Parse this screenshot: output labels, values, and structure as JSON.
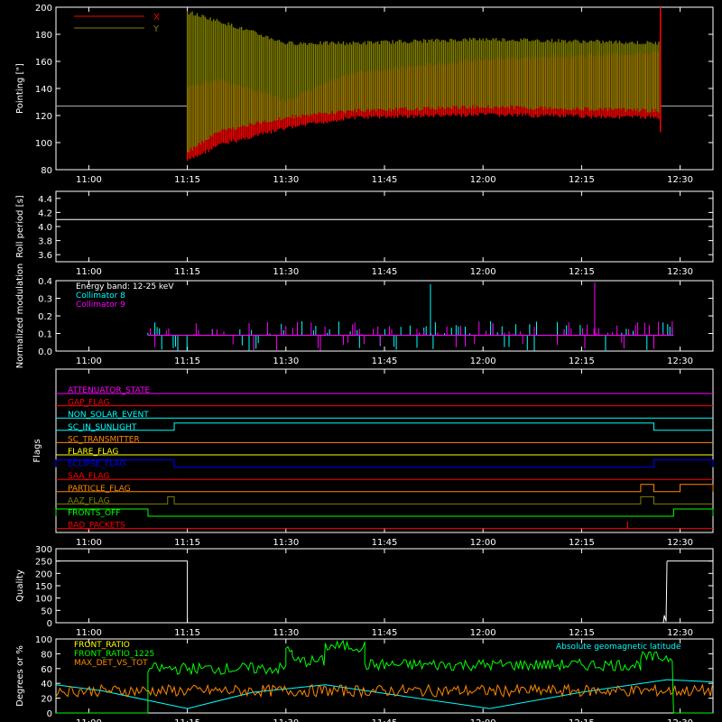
{
  "time_ticks": [
    "11:00",
    "11:15",
    "11:30",
    "11:45",
    "12:00",
    "12:15",
    "12:30"
  ],
  "colors": {
    "x": "#ff0000",
    "y": "#808000",
    "white": "#ffffff",
    "cyan": "#00ffff",
    "magenta": "#ff00ff",
    "green": "#00ff00",
    "orange": "#ff8800",
    "blue": "#0000ff"
  },
  "chart_data": [
    {
      "type": "line",
      "ylabel": "Pointing [\"]",
      "ylim": [
        80,
        200
      ],
      "yticks": [
        80,
        100,
        120,
        140,
        160,
        180,
        200
      ],
      "legend": [
        {
          "label": "X",
          "color": "#ff0000"
        },
        {
          "label": "Y",
          "color": "#808000"
        }
      ],
      "baseline": 127,
      "oscillation_start": "11:15",
      "oscillation_end": "12:27",
      "series": [
        {
          "name": "X",
          "color": "#ff0000",
          "envelope_time": [
            "11:15",
            "11:20",
            "11:30",
            "11:40",
            "12:00",
            "12:27"
          ],
          "envelope_low": [
            88,
            100,
            112,
            120,
            122,
            120
          ],
          "envelope_high": [
            140,
            145,
            130,
            150,
            160,
            165
          ]
        },
        {
          "name": "Y",
          "color": "#808000",
          "envelope_time": [
            "11:15",
            "11:20",
            "11:30",
            "11:40",
            "12:00",
            "12:27"
          ],
          "envelope_low": [
            95,
            110,
            120,
            125,
            128,
            125
          ],
          "envelope_high": [
            195,
            188,
            172,
            172,
            175,
            172
          ]
        }
      ]
    },
    {
      "type": "line",
      "ylabel": "Roll period [s]",
      "ylim": [
        3.5,
        4.5
      ],
      "yticks": [
        3.6,
        3.8,
        4.0,
        4.2,
        4.4
      ],
      "value": 4.1
    },
    {
      "type": "line",
      "ylabel": "Normalized modulation",
      "ylim": [
        0,
        0.4
      ],
      "yticks": [
        0.0,
        0.1,
        0.2,
        0.3,
        0.4
      ],
      "start": "11:09",
      "end": "12:29",
      "baseline": 0.09,
      "legend": [
        {
          "label": "Energy band: 12-25 keV",
          "color": "#ffffff"
        },
        {
          "label": "Collimator 8",
          "color": "#00ffff"
        },
        {
          "label": "Collimator 9",
          "color": "#ff00ff"
        }
      ]
    },
    {
      "type": "line",
      "ylabel": "Flags",
      "flags": [
        {
          "label": "ATTENUATOR_STATE",
          "color": "#ff00ff",
          "steps": []
        },
        {
          "label": "GAP_FLAG",
          "color": "#ff0000",
          "steps": []
        },
        {
          "label": "NON_SOLAR_EVENT",
          "color": "#00ffff",
          "steps": []
        },
        {
          "label": "SC_IN_SUNLIGHT",
          "color": "#00ffff",
          "steps": [
            [
              "11:13",
              "12:26"
            ]
          ]
        },
        {
          "label": "SC_TRANSMITTER",
          "color": "#ff8800",
          "steps": []
        },
        {
          "label": "FLARE_FLAG",
          "color": "#ffff00",
          "steps": []
        },
        {
          "label": "ECLIPSE_FLAG",
          "color": "#0000ff",
          "steps": [
            [
              "10:55",
              "11:13"
            ],
            [
              "12:26",
              "12:35"
            ]
          ]
        },
        {
          "label": "SAA_FLAG",
          "color": "#ff0000",
          "steps": []
        },
        {
          "label": "PARTICLE_FLAG",
          "color": "#ff8800",
          "steps": [
            [
              "12:24",
              "12:26"
            ],
            [
              "12:30",
              "12:35"
            ]
          ]
        },
        {
          "label": "AAZ_FLAG",
          "color": "#808000",
          "steps": [
            [
              "11:12",
              "11:13"
            ],
            [
              "12:24",
              "12:26"
            ]
          ]
        },
        {
          "label": "FRONTS_OFF",
          "color": "#00ff00",
          "steps": [
            [
              "10:55",
              "11:09"
            ],
            [
              "12:29",
              "12:35"
            ]
          ]
        },
        {
          "label": "BAD_PACKETS",
          "color": "#ff0000",
          "steps": [
            [
              "12:22",
              "12:22"
            ]
          ]
        }
      ]
    },
    {
      "type": "line",
      "ylabel": "Quality",
      "ylim": [
        0,
        300
      ],
      "yticks": [
        0,
        50,
        100,
        150,
        200,
        250,
        300
      ],
      "segments": [
        {
          "start": "10:55",
          "end": "11:15",
          "value": 250
        },
        {
          "start": "12:28",
          "end": "12:35",
          "value": 250
        }
      ]
    },
    {
      "type": "line",
      "ylabel": "Degrees or %",
      "ylim": [
        0,
        100
      ],
      "yticks": [
        0,
        20,
        40,
        60,
        80,
        100
      ],
      "legend": [
        {
          "label": "FRONT_RATIO",
          "color": "#ffff00"
        },
        {
          "label": "FRONT_RATIO_1225",
          "color": "#00ff00"
        },
        {
          "label": "MAX_DET_VS_TOT",
          "color": "#ff8800"
        }
      ],
      "right_legend": {
        "label": "Absolute geomagnetic latitude",
        "color": "#00ffff"
      },
      "green_levels": [
        {
          "start": "11:09",
          "end": "11:30",
          "value": 60
        },
        {
          "start": "11:30",
          "end": "11:31",
          "value": 88
        },
        {
          "start": "11:31",
          "end": "11:36",
          "value": 70
        },
        {
          "start": "11:36",
          "end": "11:42",
          "value": 90
        },
        {
          "start": "11:42",
          "end": "12:24",
          "value": 65
        },
        {
          "start": "12:24",
          "end": "12:29",
          "value": 75
        }
      ],
      "orange_level": 30,
      "cyan_points": {
        "time": [
          "10:55",
          "11:02",
          "11:15",
          "11:25",
          "11:36",
          "11:50",
          "12:01",
          "12:15",
          "12:28",
          "12:35"
        ],
        "value": [
          38,
          30,
          6,
          28,
          38,
          20,
          6,
          28,
          45,
          42
        ]
      }
    }
  ]
}
